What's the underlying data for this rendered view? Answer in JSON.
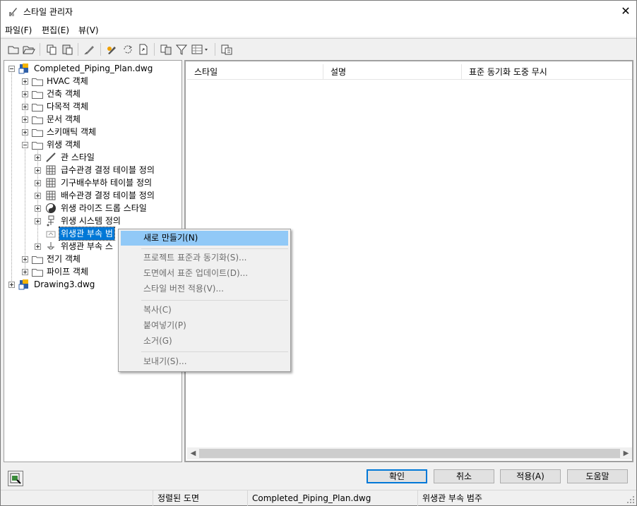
{
  "window": {
    "title": "스타일 관리자",
    "close_glyph": "✕"
  },
  "menu": [
    "파일(F)",
    "편집(E)",
    "뷰(V)"
  ],
  "toolbar": {
    "icons": [
      "new-icon",
      "open-icon",
      "copy-icon",
      "paste-icon",
      "purge-icon",
      "edit-style-icon",
      "sync-icon",
      "export-icon",
      "toggle-view-icon",
      "filter-icon",
      "view-options-icon",
      "help-icon"
    ]
  },
  "tree": {
    "items": [
      {
        "label": "Completed_Piping_Plan.dwg",
        "kind": "drawing"
      },
      {
        "label": "HVAC 객체",
        "kind": "folder"
      },
      {
        "label": "건축 객체",
        "kind": "folder"
      },
      {
        "label": "다목적 객체",
        "kind": "folder"
      },
      {
        "label": "문서 객체",
        "kind": "folder"
      },
      {
        "label": "스키매틱 객체",
        "kind": "folder"
      },
      {
        "label": "위생 객체",
        "kind": "folder"
      },
      {
        "label": "관 스타일",
        "kind": "pipe-style"
      },
      {
        "label": "급수관경 결정 테이블 정의",
        "kind": "table"
      },
      {
        "label": "기구배수부하 테이블 정의",
        "kind": "table"
      },
      {
        "label": "배수관경 결정 테이블 정의",
        "kind": "table"
      },
      {
        "label": "위생 라이즈 드롭 스타일",
        "kind": "rise-drop"
      },
      {
        "label": "위생 시스템 정의",
        "kind": "system"
      },
      {
        "label": "위생관 부속 범",
        "kind": "category"
      },
      {
        "label": "위생관 부속 스",
        "kind": "fitting"
      },
      {
        "label": "전기 객체",
        "kind": "folder"
      },
      {
        "label": "파이프 객체",
        "kind": "folder"
      },
      {
        "label": "Drawing3.dwg",
        "kind": "drawing"
      }
    ]
  },
  "list": {
    "columns": [
      "스타일",
      "설명",
      "표준 동기화 도중 무시"
    ]
  },
  "context_menu": {
    "items": [
      {
        "label": "새로 만들기(N)",
        "enabled": true
      },
      {
        "label": "프로젝트 표준과 동기화(S)...",
        "enabled": false
      },
      {
        "label": "도면에서 표준 업데이트(D)...",
        "enabled": false
      },
      {
        "label": "스타일 버전 적용(V)...",
        "enabled": false
      },
      {
        "label": "복사(C)",
        "enabled": false
      },
      {
        "label": "붙여넣기(P)",
        "enabled": false
      },
      {
        "label": "소거(G)",
        "enabled": false
      },
      {
        "label": "보내기(S)...",
        "enabled": false
      }
    ]
  },
  "buttons": {
    "ok": "확인",
    "cancel": "취소",
    "apply": "적용(A)",
    "help": "도움말"
  },
  "status": {
    "sort": "정렬된 도면",
    "drawing": "Completed_Piping_Plan.dwg",
    "category": "위생관 부속 범주"
  },
  "colors": {
    "selection": "#0078d7",
    "menu_highlight": "#91c9f7"
  }
}
